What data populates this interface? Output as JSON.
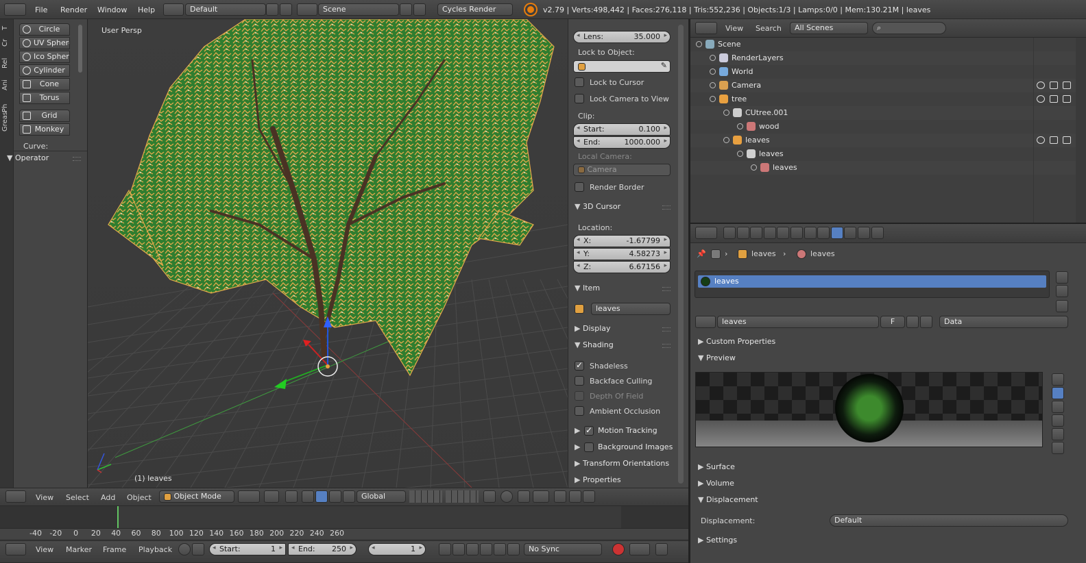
{
  "info_header": {
    "menus": [
      "File",
      "Render",
      "Window",
      "Help"
    ],
    "screen_layout": "Default",
    "scene": "Scene",
    "engine": "Cycles Render",
    "stats": "v2.79 | Verts:498,442 | Faces:276,118 | Tris:552,236 | Objects:1/3 | Lamps:0/0 | Mem:130.21M | leaves"
  },
  "tool_tabs": [
    "T",
    "Cr",
    "Rel",
    "Ani",
    "Ph",
    "Greas"
  ],
  "tool_shelf": {
    "mesh_buttons": [
      "Circle",
      "UV Sphere",
      "Ico Sphere",
      "Cylinder",
      "Cone",
      "Torus",
      "Grid",
      "Monkey"
    ],
    "curve_label": "Curve:",
    "operator_label": "Operator"
  },
  "viewport": {
    "view_label": "User Persp",
    "object_label": "(1) leaves"
  },
  "n_panel": {
    "lens_label": "Lens:",
    "lens_value": "35.000",
    "lock_object_label": "Lock to Object:",
    "lock_cursor": "Lock to Cursor",
    "lock_camera": "Lock Camera to View",
    "clip_label": "Clip:",
    "clip_start_label": "Start:",
    "clip_start": "0.100",
    "clip_end_label": "End:",
    "clip_end": "1000.000",
    "local_camera_label": "Local Camera:",
    "local_camera_value": "Camera",
    "render_border": "Render Border",
    "cursor_panel": "3D Cursor",
    "location_label": "Location:",
    "loc_x_label": "X:",
    "loc_x": "-1.67799",
    "loc_y_label": "Y:",
    "loc_y": "4.58273",
    "loc_z_label": "Z:",
    "loc_z": "6.67156",
    "item_panel": "Item",
    "item_name": "leaves",
    "display_panel": "Display",
    "shading_panel": "Shading",
    "shadeless": "Shadeless",
    "backface": "Backface Culling",
    "dof": "Depth Of Field",
    "ao": "Ambient Occlusion",
    "motion_tracking": "Motion Tracking",
    "background_images": "Background Images",
    "transform_orient": "Transform Orientations",
    "properties": "Properties"
  },
  "view3d_header": {
    "menus": [
      "View",
      "Select",
      "Add",
      "Object"
    ],
    "mode": "Object Mode",
    "orientation": "Global"
  },
  "timeline": {
    "ticks": [
      "-40",
      "-20",
      "0",
      "20",
      "40",
      "60",
      "80",
      "100",
      "120",
      "140",
      "160",
      "180",
      "200",
      "220",
      "240",
      "260"
    ],
    "menus": [
      "View",
      "Marker",
      "Frame",
      "Playback"
    ],
    "start_label": "Start:",
    "start": "1",
    "end_label": "End:",
    "end": "250",
    "current": "1",
    "sync": "No Sync"
  },
  "outliner": {
    "menus": [
      "View",
      "Search"
    ],
    "filter": "All Scenes",
    "rows": [
      "Scene",
      "RenderLayers",
      "World",
      "Camera",
      "tree",
      "CUtree.001",
      "wood",
      "leaves",
      "leaves",
      "leaves"
    ]
  },
  "properties_editor": {
    "breadcrumb": [
      "leaves",
      "leaves"
    ],
    "slot_name": "leaves",
    "material_name": "leaves",
    "fake_user": "F",
    "link": "Data",
    "panels": {
      "custom": "Custom Properties",
      "preview": "Preview",
      "surface": "Surface",
      "volume": "Volume",
      "displacement": "Displacement",
      "settings": "Settings"
    },
    "displacement_label": "Displacement:",
    "displacement_value": "Default"
  },
  "colors": {
    "accent": "#5680c2",
    "foliage": "#2f7d2f",
    "leaf_outline": "#e3a94b",
    "grid": "#4a4a4a"
  }
}
